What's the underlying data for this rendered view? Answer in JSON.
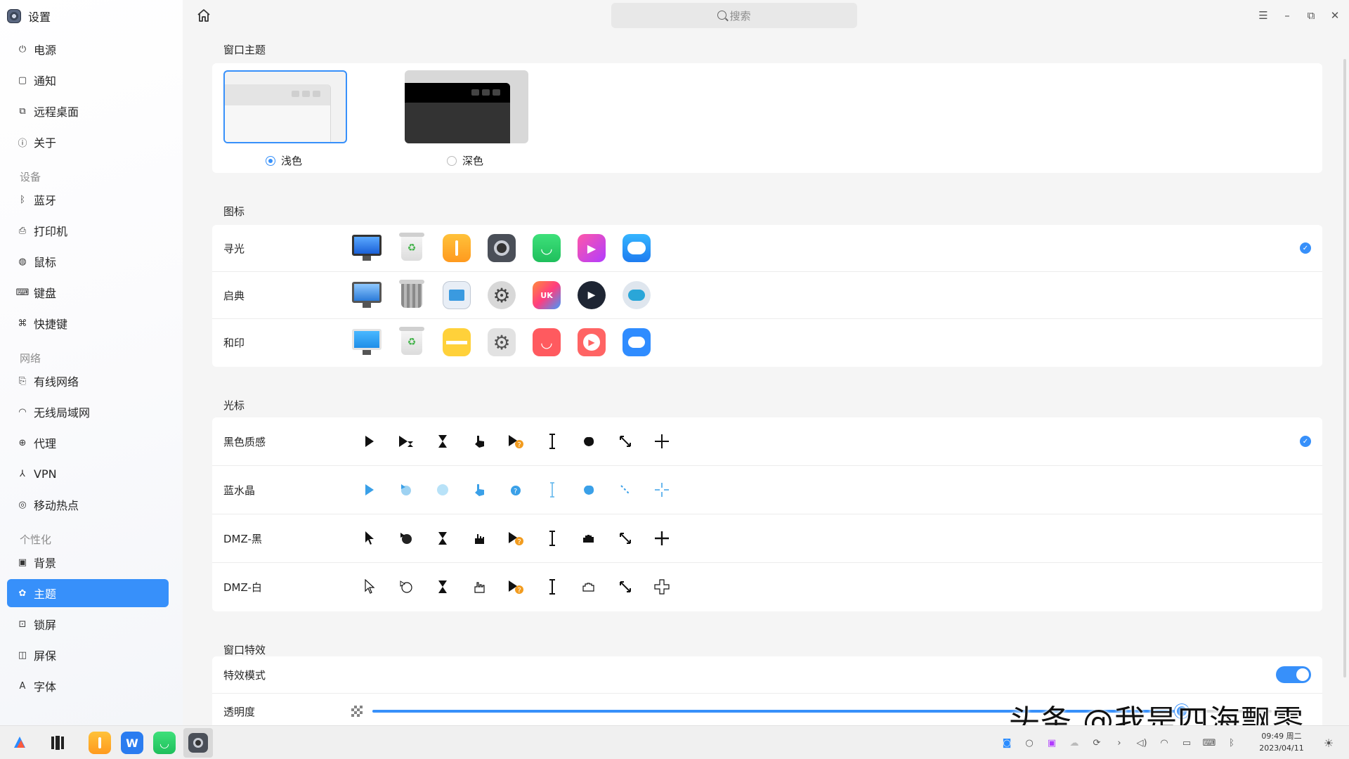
{
  "app": {
    "title": "设置"
  },
  "sidebar": {
    "items": [
      {
        "label": "电源",
        "icon": "power-icon"
      },
      {
        "label": "通知",
        "icon": "message-icon"
      },
      {
        "label": "远程桌面",
        "icon": "remote-desktop-icon"
      },
      {
        "label": "关于",
        "icon": "info-icon"
      }
    ],
    "groups": [
      {
        "label": "设备",
        "items": [
          {
            "label": "蓝牙",
            "icon": "bluetooth-icon"
          },
          {
            "label": "打印机",
            "icon": "printer-icon"
          },
          {
            "label": "鼠标",
            "icon": "mouse-icon"
          },
          {
            "label": "键盘",
            "icon": "keyboard-icon"
          },
          {
            "label": "快捷键",
            "icon": "shortcut-icon"
          }
        ]
      },
      {
        "label": "网络",
        "items": [
          {
            "label": "有线网络",
            "icon": "wired-network-icon"
          },
          {
            "label": "无线局域网",
            "icon": "wifi-icon"
          },
          {
            "label": "代理",
            "icon": "proxy-icon"
          },
          {
            "label": "VPN",
            "icon": "vpn-icon"
          },
          {
            "label": "移动热点",
            "icon": "hotspot-icon"
          }
        ]
      },
      {
        "label": "个性化",
        "items": [
          {
            "label": "背景",
            "icon": "image-icon"
          },
          {
            "label": "主题",
            "icon": "palette-icon",
            "active": true
          },
          {
            "label": "锁屏",
            "icon": "lock-screen-icon"
          },
          {
            "label": "屏保",
            "icon": "screensaver-icon"
          },
          {
            "label": "字体",
            "icon": "font-icon"
          }
        ]
      }
    ]
  },
  "search": {
    "placeholder": "搜索"
  },
  "window_theme": {
    "title": "窗口主题",
    "options": [
      {
        "label": "浅色",
        "selected": true
      },
      {
        "label": "深色",
        "selected": false
      }
    ]
  },
  "icon_theme": {
    "title": "图标",
    "rows": [
      {
        "label": "寻光",
        "selected": true
      },
      {
        "label": "启典",
        "selected": false
      },
      {
        "label": "和印",
        "selected": false
      }
    ]
  },
  "cursor_theme": {
    "title": "光标",
    "rows": [
      {
        "label": "黑色质感",
        "selected": true
      },
      {
        "label": "蓝水晶",
        "selected": false
      },
      {
        "label": "DMZ-黑",
        "selected": false
      },
      {
        "label": "DMZ-白",
        "selected": false
      }
    ]
  },
  "window_effects": {
    "title": "窗口特效",
    "effect_mode_label": "特效模式",
    "effect_mode_on": true,
    "transparency_label": "透明度",
    "transparency_level": 0.9
  },
  "taskbar": {
    "time": "09:49 周二",
    "date": "2023/04/11"
  },
  "watermark": "头条 @我是四海飘零",
  "colors": {
    "accent": "#3790fa",
    "sidebar_active": "#3790fa"
  }
}
